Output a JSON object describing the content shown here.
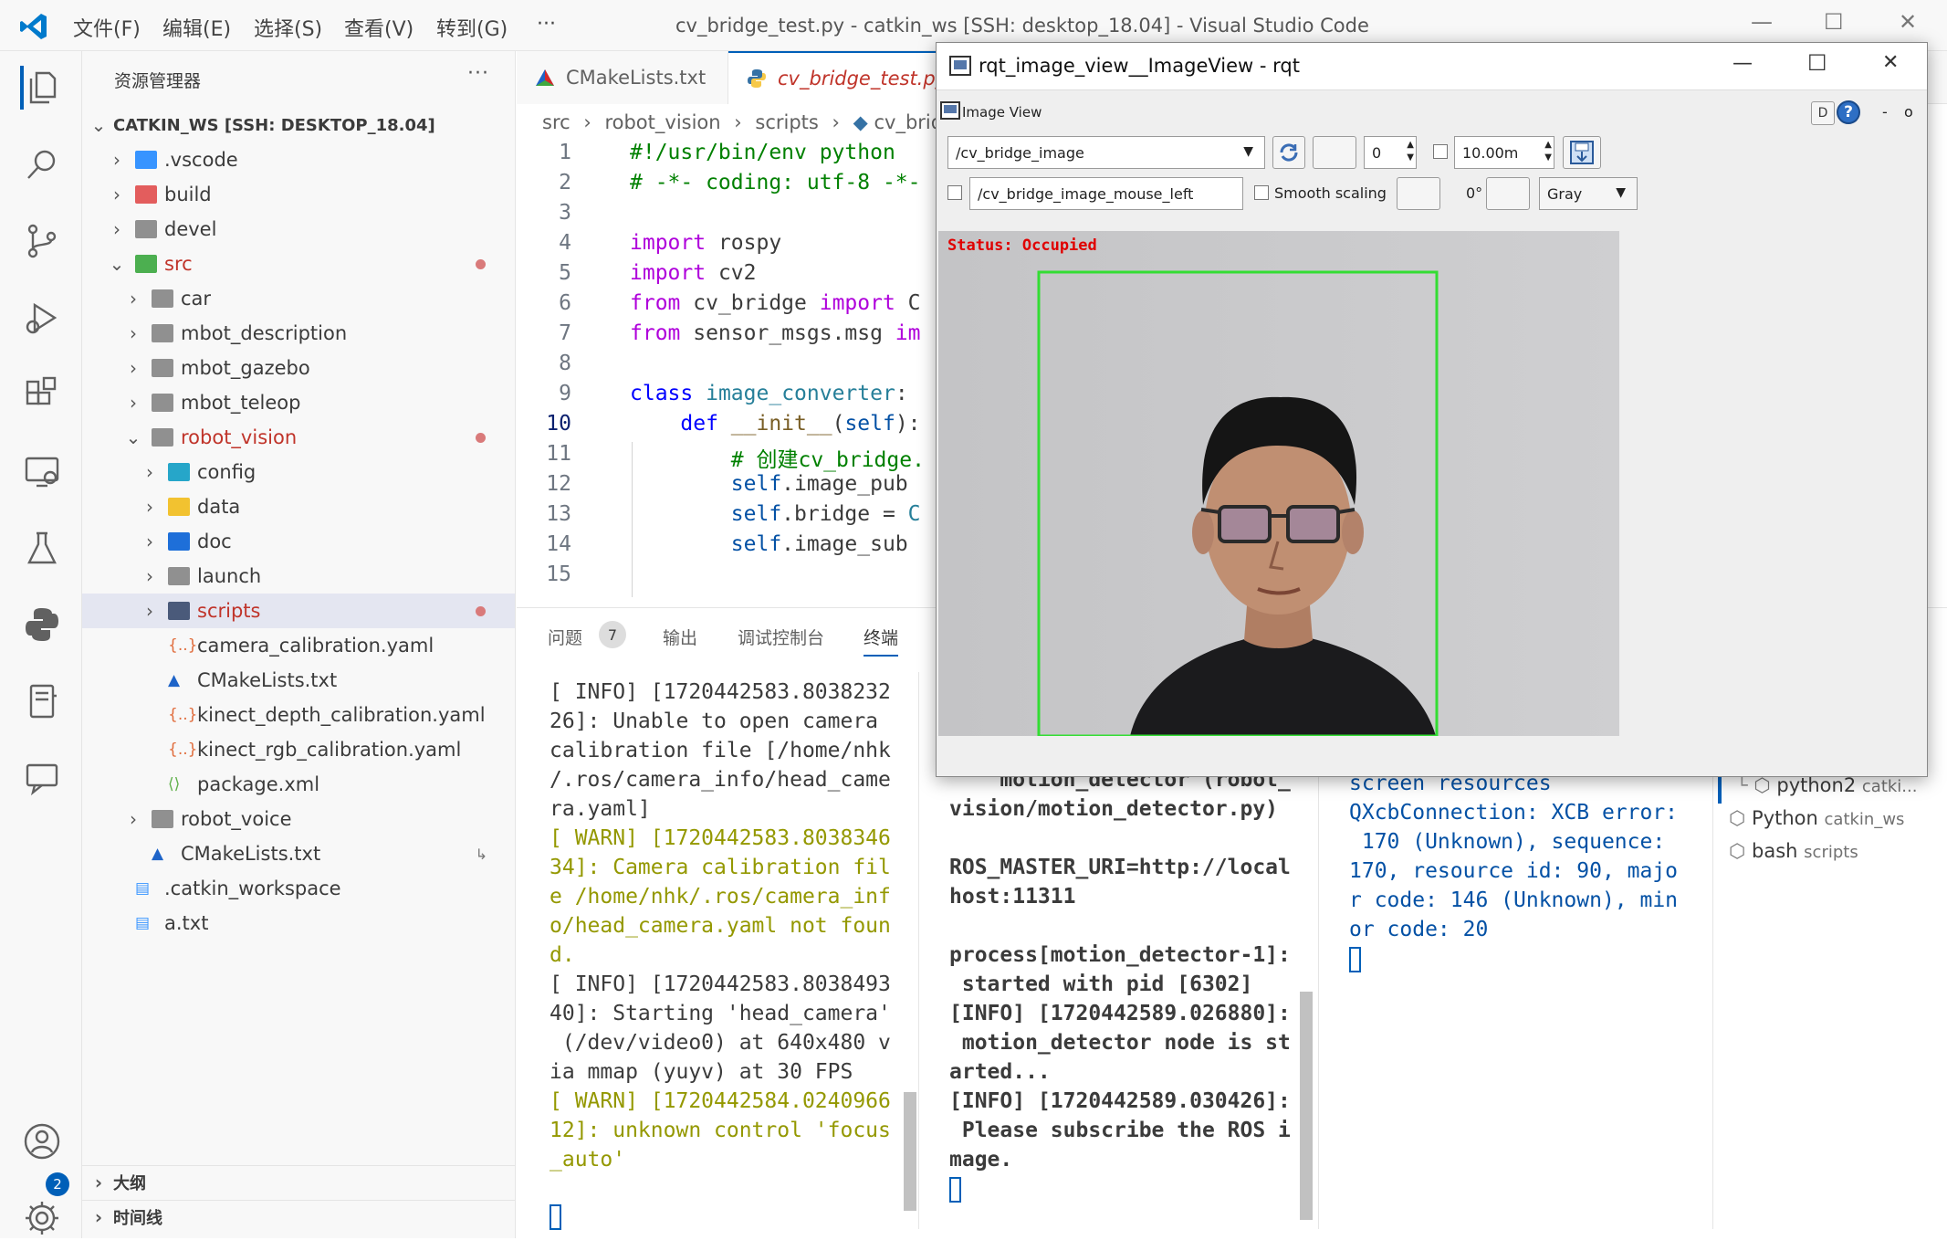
{
  "titlebar": {
    "menu": [
      "文件(F)",
      "编辑(E)",
      "选择(S)",
      "查看(V)",
      "转到(G)",
      "···"
    ],
    "title": "cv_bridge_test.py - catkin_ws [SSH: desktop_18.04] - Visual Studio Code"
  },
  "activity": {
    "accounts_badge": "2"
  },
  "sidebar": {
    "header": "资源管理器",
    "more": "···",
    "root": "CATKIN_WS [SSH: DESKTOP_18.04]",
    "items": [
      {
        "label": ".vscode"
      },
      {
        "label": "build"
      },
      {
        "label": "devel"
      },
      {
        "label": "src"
      },
      {
        "label": "car"
      },
      {
        "label": "mbot_description"
      },
      {
        "label": "mbot_gazebo"
      },
      {
        "label": "mbot_teleop"
      },
      {
        "label": "robot_vision"
      },
      {
        "label": "config"
      },
      {
        "label": "data"
      },
      {
        "label": "doc"
      },
      {
        "label": "launch"
      },
      {
        "label": "scripts"
      },
      {
        "label": "camera_calibration.yaml"
      },
      {
        "label": "CMakeLists.txt"
      },
      {
        "label": "kinect_depth_calibration.yaml"
      },
      {
        "label": "kinect_rgb_calibration.yaml"
      },
      {
        "label": "package.xml"
      },
      {
        "label": "robot_voice"
      },
      {
        "label": "CMakeLists.txt"
      },
      {
        "label": ".catkin_workspace"
      },
      {
        "label": "a.txt"
      }
    ],
    "sections": [
      "大纲",
      "时间线"
    ]
  },
  "editor": {
    "tabs": [
      "CMakeLists.txt",
      "cv_bridge_test.py"
    ],
    "breadcrumb": [
      "src",
      "robot_vision",
      "scripts",
      "cv_bridge"
    ],
    "line_numbers": [
      "1",
      "2",
      "3",
      "4",
      "5",
      "6",
      "7",
      "8",
      "9",
      "10",
      "11",
      "12",
      "13",
      "14",
      "15"
    ]
  },
  "panel": {
    "tabs": [
      "问题",
      "输出",
      "调试控制台",
      "终端"
    ],
    "problems_count": "7",
    "terminal1": [
      "[ INFO] [1720442583.8038232",
      "26]: Unable to open camera",
      "calibration file [/home/nhk",
      "/.ros/camera_info/head_came",
      "ra.yaml]",
      "[ WARN] [1720442583.8038346",
      "34]: Camera calibration fil",
      "e /home/nhk/.ros/camera_inf",
      "o/head_camera.yaml not foun",
      "d.",
      "[ INFO] [1720442583.8038493",
      "40]: Starting 'head_camera'",
      " (/dev/video0) at 640x480 v",
      "ia mmap (yuyv) at 30 FPS",
      "[ WARN] [1720442584.0240966",
      "12]: unknown control 'focus",
      "_auto'"
    ],
    "terminal2": [
      "/",
      "    motion_detector (robot_",
      "vision/motion_detector.py)",
      "",
      "ROS_MASTER_URI=http://local",
      "host:11311",
      "",
      "process[motion_detector-1]:",
      " started with pid [6302]",
      "[INFO] [1720442589.026880]:",
      " motion_detector node is st",
      "arted...",
      "[INFO] [1720442589.030426]:",
      " Please subscribe the ROS i",
      "mage."
    ],
    "terminal3": [
      "screen resources",
      "QXcbConnection: XCB error:",
      " 170 (Unknown), sequence:",
      "170, resource id: 90, majo",
      "r code: 146 (Unknown), min",
      "or code: 20"
    ],
    "terminal_list": [
      {
        "name": "python2",
        "sub": "catki..."
      },
      {
        "name": "Python",
        "sub": "catkin_ws"
      },
      {
        "name": "bash",
        "sub": "scripts"
      }
    ]
  },
  "rqt": {
    "title": "rqt_image_view__ImageView - rqt",
    "plugin_title": "Image View",
    "topic": "/cv_bridge_image",
    "spin_value": "0",
    "rate": "10.00m",
    "mouse_topic": "/cv_bridge_image_mouse_left",
    "smooth_label": "Smooth scaling",
    "rotation": "0°",
    "colormap": "Gray",
    "status": "Status: Occupied",
    "d_btn": "D",
    "help_btn": "?",
    "dash": "-",
    "o": "o"
  },
  "colors": {
    "accent": "#005fb8",
    "status_red": "#e00000",
    "detect_box": "#33dd33"
  }
}
